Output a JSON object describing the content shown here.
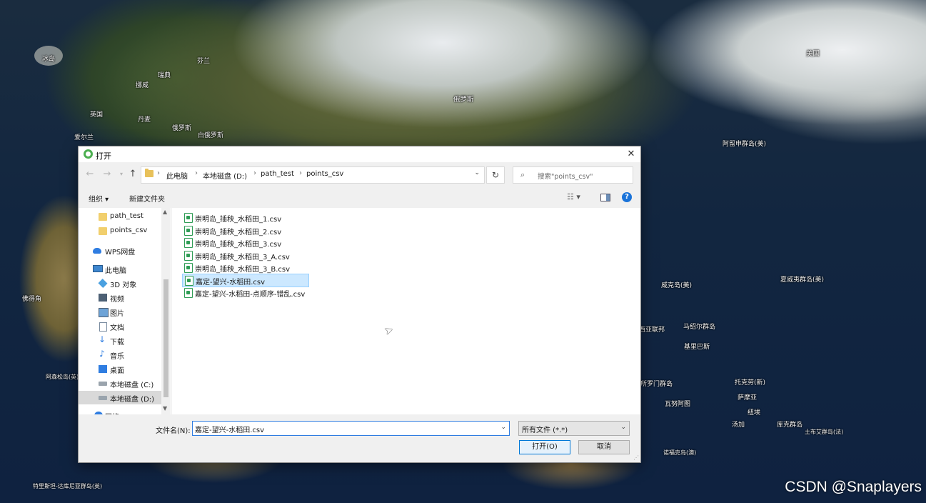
{
  "map": {
    "labels": [
      "冰岛",
      "芬兰",
      "瑞典",
      "挪威",
      "英国",
      "丹麦",
      "俄罗斯",
      "白俄罗斯",
      "爱尔兰",
      "俄罗斯",
      "美国",
      "阿留申群岛(美)",
      "威克岛(美)",
      "夏威夷群岛(美)",
      "密克罗尼西亚联邦",
      "马绍尔群岛",
      "基里巴斯",
      "所罗门群岛",
      "托克劳(新)",
      "萨摩亚",
      "瓦努阿图",
      "纽埃",
      "汤加",
      "库克群岛",
      "土布艾群岛(法)",
      "诺福克岛(澳)",
      "佛得角",
      "阿森松岛(英)",
      "特里斯坦-达库尼亚群岛(英)"
    ]
  },
  "dialog": {
    "title": "打开",
    "close": "✕",
    "breadcrumbs": [
      "此电脑",
      "本地磁盘 (D:)",
      "path_test",
      "points_csv"
    ],
    "search_placeholder": "搜索\"points_csv\"",
    "toolbar": {
      "organize": "组织 ▾",
      "new_folder": "新建文件夹",
      "help": "?"
    },
    "nav": [
      {
        "label": "path_test",
        "icon": "folder-icon"
      },
      {
        "label": "points_csv",
        "icon": "folder-icon"
      },
      {
        "label": "WPS网盘",
        "icon": "cloud-icon"
      },
      {
        "label": "此电脑",
        "icon": "pc-icon"
      },
      {
        "label": "3D 对象",
        "icon": "3d-objects-icon"
      },
      {
        "label": "视频",
        "icon": "video-icon"
      },
      {
        "label": "图片",
        "icon": "pictures-icon"
      },
      {
        "label": "文档",
        "icon": "documents-icon"
      },
      {
        "label": "下载",
        "icon": "download-icon"
      },
      {
        "label": "音乐",
        "icon": "music-icon"
      },
      {
        "label": "桌面",
        "icon": "desktop-icon"
      },
      {
        "label": "本地磁盘 (C:)",
        "icon": "drive-icon"
      },
      {
        "label": "本地磁盘 (D:)",
        "icon": "drive-icon"
      },
      {
        "label": "网络",
        "icon": "network-icon"
      }
    ],
    "files": [
      "崇明岛_插秧_水稻田_1.csv",
      "崇明岛_插秧_水稻田_2.csv",
      "崇明岛_插秧_水稻田_3.csv",
      "崇明岛_插秧_水稻田_3_A.csv",
      "崇明岛_插秧_水稻田_3_B.csv",
      "嘉定-望兴-水稻田.csv",
      "嘉定-望兴-水稻田-点顺序-错乱.csv"
    ],
    "selected_file_index": 5,
    "filename_label": "文件名(N):",
    "filename_value": "嘉定-望兴-水稻田.csv",
    "filetype_value": "所有文件 (*.*)",
    "open_label": "打开(O)",
    "cancel_label": "取消"
  },
  "watermark": "CSDN @Snaplayers",
  "colors": {
    "accent": "#0078d7",
    "selection": "#cce8ff",
    "folder": "#f1cf6d"
  }
}
